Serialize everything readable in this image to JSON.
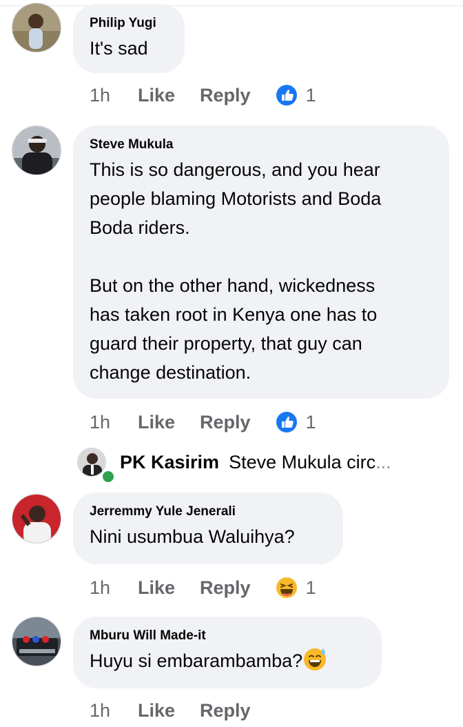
{
  "actions": {
    "like": "Like",
    "reply": "Reply"
  },
  "comments": [
    {
      "author": "Philip Yugi",
      "text": "It's sad",
      "time": "1h",
      "reaction_icon": "like-icon",
      "reaction_count": "1"
    },
    {
      "author": "Steve Mukula",
      "text": "This is so dangerous, and you hear\npeople blaming Motorists and Boda\nBoda riders.\n\nBut on the other hand, wickedness\nhas taken root in Kenya one has to\nguard their property, that guy can\nchange destination.",
      "time": "1h",
      "reaction_icon": "like-icon",
      "reaction_count": "1"
    },
    {
      "author": "Jerremmy Yule Jenerali",
      "text": "Nini usumbua Waluihya?",
      "time": "1h",
      "reaction_icon": "laughing-emoji-icon",
      "reaction_count": "1"
    },
    {
      "author": "Mburu Will Made-it",
      "text": "Huyu si embarambamba?",
      "text_emoji": "sweat-smile-emoji-icon",
      "time": "1h"
    }
  ],
  "reply_preview": {
    "author": "PK Kasirim",
    "snippet": "Steve Mukula circ",
    "ellipsis": "..."
  },
  "colors": {
    "bubble": "#f0f2f5",
    "meta": "#65676b",
    "like_blue": "#1877f2",
    "online": "#31a24c"
  }
}
